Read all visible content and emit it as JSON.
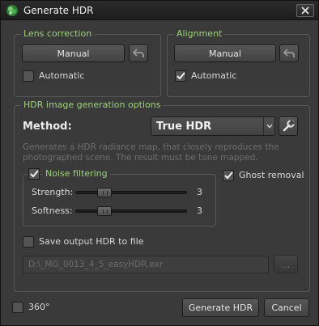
{
  "window": {
    "title": "Generate HDR"
  },
  "lens_correction": {
    "legend": "Lens correction",
    "button_label": "Manual",
    "automatic_label": "Automatic",
    "automatic_checked": false
  },
  "alignment": {
    "legend": "Alignment",
    "button_label": "Manual",
    "automatic_label": "Automatic",
    "automatic_checked": true
  },
  "hdr_options": {
    "legend": "HDR image generation options",
    "method_label": "Method:",
    "method_value": "True HDR",
    "description_line1": "Generates a HDR radiance map, that closely reproduces the",
    "description_line2": "photographed scene. The result must be tone mapped.",
    "noise_filtering": {
      "label": "Noise filtering",
      "checked": true,
      "strength_label": "Strength:",
      "strength_value": "3",
      "softness_label": "Softness:",
      "softness_value": "3"
    },
    "ghost_removal_label": "Ghost removal",
    "ghost_removal_checked": true,
    "save_output_label": "Save output HDR to file",
    "save_output_checked": false,
    "output_path": "D:\\_MG_0013_4_5_easyHDR.exr",
    "browse_label": "..."
  },
  "footer": {
    "panorama_label": "360°",
    "panorama_checked": false,
    "generate_label": "Generate HDR",
    "cancel_label": "Cancel"
  },
  "icons": {
    "app": "app-logo-icon",
    "close": "close-icon",
    "undo": "undo-arrow-icon",
    "settings": "wrench-icon",
    "dropdown": "chevron-down-icon",
    "check": "checkmark-icon"
  },
  "colors": {
    "legend_text": "#9ed27a",
    "window_bg": "#3a3a3a",
    "app_icon": "#4caf50"
  }
}
